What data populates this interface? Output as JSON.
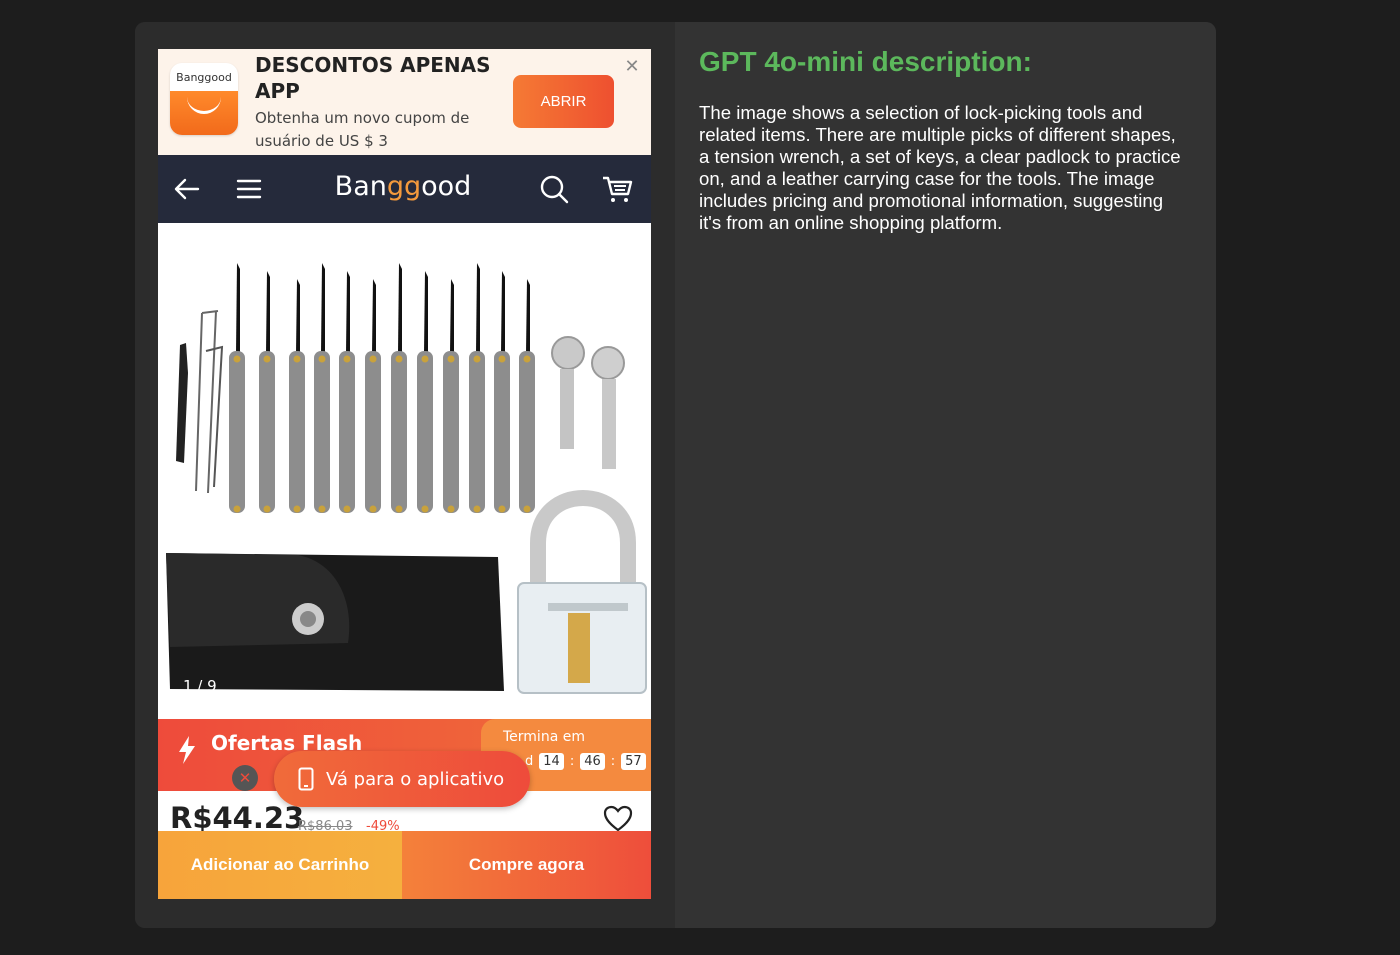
{
  "banner": {
    "logo_text": "Banggood",
    "title": "DESCONTOS APENAS APP",
    "subtitle": "Obtenha um novo cupom de usuário de US $ 3",
    "open_button": "ABRIR",
    "close_icon": "close-icon"
  },
  "nav": {
    "brand_prefix": "Ban",
    "brand_gg": "gg",
    "brand_suffix": "ood",
    "icons": [
      "back-arrow-icon",
      "menu-icon",
      "search-icon",
      "cart-icon"
    ]
  },
  "product": {
    "image_counter": "1 / 9",
    "price": "R$44.23",
    "old_price": "R$86.03",
    "discount": "-49%"
  },
  "flash": {
    "title": "Ofertas Flash",
    "ends_label": "Termina em",
    "days_suffix": "d",
    "hours": "14",
    "minutes": "46",
    "seconds": "57",
    "icon": "lightning-icon"
  },
  "go_app": {
    "label": "Vá para o aplicativo",
    "icon": "phone-icon"
  },
  "actions": {
    "add_to_cart": "Adicionar ao Carrinho",
    "buy_now": "Compre agora"
  },
  "description": {
    "title": "GPT 4o-mini description:",
    "body": "The image shows a selection of lock-picking tools and related items. There are multiple picks of different shapes, a tension wrench, a set of keys, a clear padlock to practice on, and a leather carrying case for the tools. The image includes pricing and promotional information, suggesting it's from an online shopping platform."
  },
  "colors": {
    "accent_orange": "#f57a34",
    "flash_red": "#ee4b3b",
    "nav_dark": "#252a3b",
    "title_green": "#5cb85c"
  }
}
